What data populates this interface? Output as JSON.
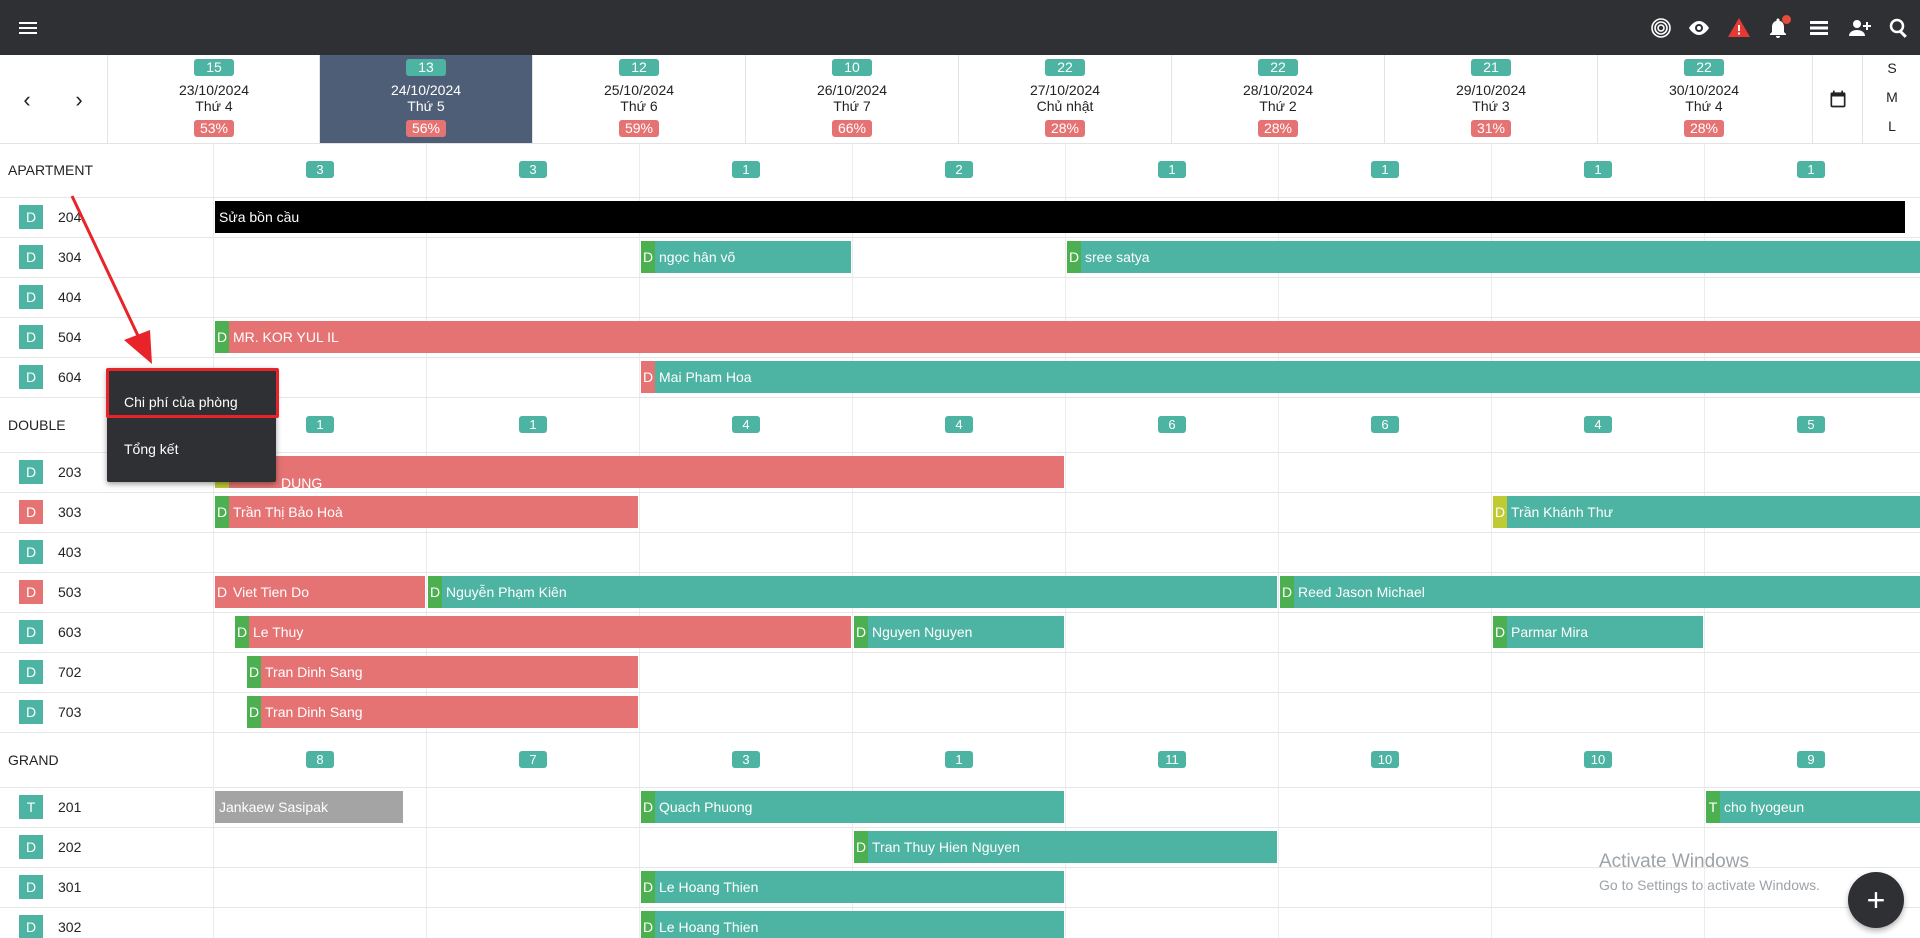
{
  "topbar": {
    "icons": [
      "menu-icon",
      "fingerprint-icon",
      "eye-icon",
      "warning-icon",
      "bell-icon",
      "list-icon",
      "add-user-icon",
      "search-icon"
    ]
  },
  "dates": [
    {
      "count": "15",
      "date": "23/10/2024",
      "dow": "Thứ 4",
      "pct": "53%"
    },
    {
      "count": "13",
      "date": "24/10/2024",
      "dow": "Thứ 5",
      "pct": "56%"
    },
    {
      "count": "12",
      "date": "25/10/2024",
      "dow": "Thứ 6",
      "pct": "59%"
    },
    {
      "count": "10",
      "date": "26/10/2024",
      "dow": "Thứ 7",
      "pct": "66%"
    },
    {
      "count": "22",
      "date": "27/10/2024",
      "dow": "Chủ nhật",
      "pct": "28%"
    },
    {
      "count": "22",
      "date": "28/10/2024",
      "dow": "Thứ 2",
      "pct": "28%"
    },
    {
      "count": "21",
      "date": "29/10/2024",
      "dow": "Thứ 3",
      "pct": "31%"
    },
    {
      "count": "22",
      "date": "30/10/2024",
      "dow": "Thứ 4",
      "pct": "28%"
    }
  ],
  "size_toggle": {
    "s": "S",
    "m": "M",
    "l": "L"
  },
  "groups": {
    "apartment": {
      "name": "APARTMENT",
      "counts": [
        "3",
        "3",
        "1",
        "2",
        "1",
        "1",
        "1",
        "1"
      ]
    },
    "double": {
      "name": "DOUBLE",
      "counts": [
        "1",
        "1",
        "4",
        "4",
        "6",
        "6",
        "4",
        "5"
      ]
    },
    "grand": {
      "name": "GRAND",
      "counts": [
        "8",
        "7",
        "3",
        "1",
        "11",
        "10",
        "10",
        "9"
      ]
    }
  },
  "rooms": {
    "r204": {
      "badge": "D",
      "num": "204"
    },
    "r304": {
      "badge": "D",
      "num": "304"
    },
    "r404": {
      "badge": "D",
      "num": "404"
    },
    "r504": {
      "badge": "D",
      "num": "504"
    },
    "r604": {
      "badge": "D",
      "num": "604"
    },
    "r203": {
      "badge": "D",
      "num": "203"
    },
    "r303": {
      "badge": "D",
      "num": "303"
    },
    "r403": {
      "badge": "D",
      "num": "403"
    },
    "r503": {
      "badge": "D",
      "num": "503"
    },
    "r603": {
      "badge": "D",
      "num": "603"
    },
    "r702": {
      "badge": "D",
      "num": "702"
    },
    "r703": {
      "badge": "D",
      "num": "703"
    },
    "r201": {
      "badge": "T",
      "num": "201"
    },
    "r202": {
      "badge": "D",
      "num": "202"
    },
    "r301": {
      "badge": "D",
      "num": "301"
    },
    "r302": {
      "badge": "D",
      "num": "302"
    }
  },
  "bookings": {
    "b204a": {
      "tag": "",
      "name": "Sửa bồn cầu"
    },
    "b304a": {
      "tag": "D",
      "name": "ngọc hân võ"
    },
    "b304b": {
      "tag": "D",
      "name": "sree satya"
    },
    "b504a": {
      "tag": "D",
      "name": "MR. KOR YUL IL"
    },
    "b604a": {
      "tag": "D",
      "name": "Mai Pham Hoa"
    },
    "b203a": {
      "tag": "",
      "name": "DUNG"
    },
    "b303a": {
      "tag": "D",
      "name": "Trần Thị Bảo Hoà"
    },
    "b303b": {
      "tag": "D",
      "name": "Trần Khánh Thư"
    },
    "b503a": {
      "tag": "D",
      "name": "Viet Tien Do"
    },
    "b503b": {
      "tag": "D",
      "name": "Nguyễn Phạm Kiên"
    },
    "b503c": {
      "tag": "D",
      "name": "Reed Jason Michael"
    },
    "b603a": {
      "tag": "D",
      "name": "Le Thuy"
    },
    "b603b": {
      "tag": "D",
      "name": "Nguyen Nguyen"
    },
    "b603c": {
      "tag": "D",
      "name": "Parmar Mira"
    },
    "b702a": {
      "tag": "D",
      "name": "Tran Dinh Sang"
    },
    "b703a": {
      "tag": "D",
      "name": "Tran Dinh Sang"
    },
    "b201a": {
      "tag": "",
      "name": "Jankaew Sasipak"
    },
    "b201b": {
      "tag": "D",
      "name": "Quach Phuong"
    },
    "b201c": {
      "tag": "T",
      "name": "cho hyogeun"
    },
    "b202a": {
      "tag": "D",
      "name": "Tran Thuy Hien Nguyen"
    },
    "b301a": {
      "tag": "D",
      "name": "Le Hoang Thien"
    },
    "b302a": {
      "tag": "D",
      "name": "Le Hoang Thien"
    }
  },
  "context_menu": {
    "item1": "Chi phí của phòng",
    "item2": "Tổng kết"
  },
  "watermark": {
    "line1": "Activate Windows",
    "line2": "Go to Settings to activate Windows."
  },
  "fab_label": "+"
}
